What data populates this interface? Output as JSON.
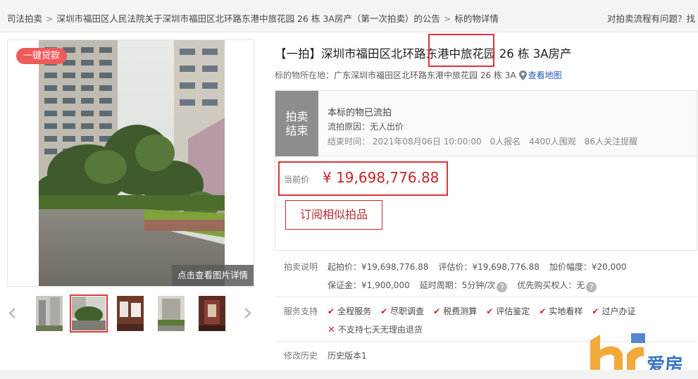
{
  "breadcrumb": {
    "items": [
      "司法拍卖",
      "深圳市福田区人民法院关于深圳市福田区北环路东港中旅花园 26 栋 3A房产（第一次拍卖）的公告",
      "标的物详情"
    ],
    "separator": ">"
  },
  "help_link": "对拍卖流程有问题？找",
  "gallery": {
    "loan_badge": "一键贷款",
    "view_details": "点击查看图片详情",
    "prev_icon": "chevron-left-icon",
    "next_icon": "chevron-right-icon",
    "thumbnail_count": 5,
    "selected_index": 1
  },
  "item": {
    "title": "【一拍】深圳市福田区北环路东港中旅花园 26 栋 3A房产",
    "location_label": "标的物所在地：",
    "location": "广东深圳市福田区北环路东港中旅花园 26 栋 3A",
    "map_link": "查看地图"
  },
  "status": {
    "tag_line1": "拍卖",
    "tag_line2": "结束",
    "headline": "本标的物已流拍",
    "reason": "流拍原因：无人出价",
    "end_time": "结束时间：  2021年08月06日 10:00:00",
    "signups": "0人报名",
    "views": "4400人围观",
    "followers": "86人关注提醒"
  },
  "price": {
    "label": "当前价",
    "value": "¥ 19,698,776.88",
    "subscribe_button": "订阅相似拍品"
  },
  "details": {
    "label": "拍卖说明",
    "start_price": "起拍价：¥19,698,776.88",
    "appraisal": "评估价：¥19,698,776.88",
    "increment": "加价幅度：¥20,000",
    "deposit": "保证金：¥1,900,000",
    "delay": "延时周期：5分钟/次",
    "priority": "优先购买权人：无"
  },
  "services": {
    "label": "服务支持",
    "items": [
      "全程服务",
      "尽职调查",
      "税费测算",
      "评估鉴定",
      "实地看样",
      "过户办证"
    ],
    "no_return": "不支持七天无理由退货"
  },
  "history": {
    "label": "修改历史",
    "value": "历史版本1"
  },
  "watermark": {
    "text": "爱房"
  },
  "colors": {
    "accent_red": "#c8232c",
    "highlight_box": "#e0323a",
    "badge_red": "#ef5b5b",
    "ended_gray": "#8d8d8d",
    "link_blue": "#2458b3"
  }
}
